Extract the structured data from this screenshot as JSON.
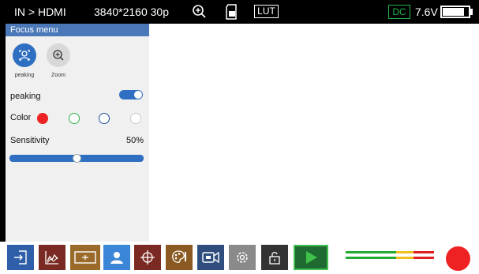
{
  "status": {
    "input": "IN > HDMI",
    "resolution": "3840*2160 30p",
    "zoom_icon": "zoom-in-icon",
    "card_icon": "sd-card-icon",
    "lut": "LUT",
    "power_source": "DC",
    "voltage": "7.6V",
    "battery_level": 0.85,
    "colors": {
      "power_source": "#1fb34a"
    }
  },
  "focus_menu": {
    "title": "Focus menu",
    "modes": [
      {
        "label": "peaking",
        "icon": "peaking-icon",
        "selected": true
      },
      {
        "label": "Zoom",
        "icon": "zoom-icon",
        "selected": false
      }
    ],
    "peaking": {
      "label": "peaking",
      "enabled": true
    },
    "color": {
      "label": "Color",
      "options": [
        "#ee2222",
        "#2db34a",
        "#1e4f9a",
        "#ffffff"
      ],
      "selected_index": 0
    },
    "sensitivity": {
      "label": "Sensitivity",
      "value_text": "50%",
      "value": 0.5
    }
  },
  "toolbar": {
    "buttons": [
      {
        "name": "input-button",
        "icon": "input-source-icon",
        "color": "#2f5fa8"
      },
      {
        "name": "waveform-button",
        "icon": "waveform-icon",
        "color": "#7a2a22"
      },
      {
        "name": "marker-button",
        "icon": "center-marker-icon",
        "color": "#9a6a2a"
      },
      {
        "name": "focus-button",
        "icon": "focus-user-icon",
        "color": "#3b86d6"
      },
      {
        "name": "crosshair-button",
        "icon": "crosshair-icon",
        "color": "#7a2a22"
      },
      {
        "name": "color-palette-button",
        "icon": "palette-icon",
        "color": "#8a5a22"
      },
      {
        "name": "record-mode-button",
        "icon": "video-camera-icon",
        "color": "#2f4e7e"
      },
      {
        "name": "settings-button",
        "icon": "gear-icon",
        "color": "#8a8a8a"
      },
      {
        "name": "lock-button",
        "icon": "lock-icon",
        "color": "#333333"
      },
      {
        "name": "play-button",
        "icon": "play-icon",
        "color": "#1f6a30"
      }
    ],
    "audio_meter": {
      "icon": "audio-meter-icon",
      "colors": [
        "#22aa33",
        "#f0c020",
        "#e02020"
      ]
    },
    "record_icon": "record-icon"
  }
}
